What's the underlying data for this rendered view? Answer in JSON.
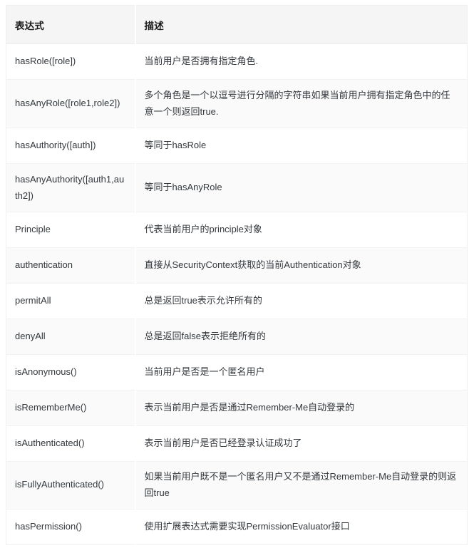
{
  "table": {
    "columns": [
      {
        "key": "expression",
        "label": "表达式"
      },
      {
        "key": "description",
        "label": "描述"
      }
    ],
    "rows": [
      {
        "expression": "hasRole([role])",
        "description": "当前用户是否拥有指定角色."
      },
      {
        "expression": "hasAnyRole([role1,role2])",
        "description": "多个角色是一个以逗号进行分隔的字符串如果当前用户拥有指定角色中的任意一个则返回true."
      },
      {
        "expression": "hasAuthority([auth])",
        "description": "等同于hasRole"
      },
      {
        "expression": "hasAnyAuthority([auth1,auth2])",
        "description": "等同于hasAnyRole"
      },
      {
        "expression": "Principle",
        "description": "代表当前用户的principle对象"
      },
      {
        "expression": "authentication",
        "description": "直接从SecurityContext获取的当前Authentication对象"
      },
      {
        "expression": "permitAll",
        "description": "总是返回true表示允许所有的"
      },
      {
        "expression": "denyAll",
        "description": "总是返回false表示拒绝所有的"
      },
      {
        "expression": "isAnonymous()",
        "description": "当前用户是否是一个匿名用户"
      },
      {
        "expression": "isRememberMe()",
        "description": "表示当前用户是否是通过Remember-Me自动登录的"
      },
      {
        "expression": "isAuthenticated()",
        "description": "表示当前用户是否已经登录认证成功了"
      },
      {
        "expression": "isFullyAuthenticated()",
        "description": "如果当前用户既不是一个匿名用户又不是通过Remember-Me自动登录的则返回true"
      },
      {
        "expression": "hasPermission()",
        "description": "使用扩展表达式需要实现PermissionEvaluator接口"
      }
    ]
  },
  "style": {
    "header_background": "#f5f5f5",
    "row_alt_background": "#fafafa",
    "row_base_background": "#ffffff",
    "text_color": "#34393d",
    "border_color": "#f0f0f0"
  }
}
